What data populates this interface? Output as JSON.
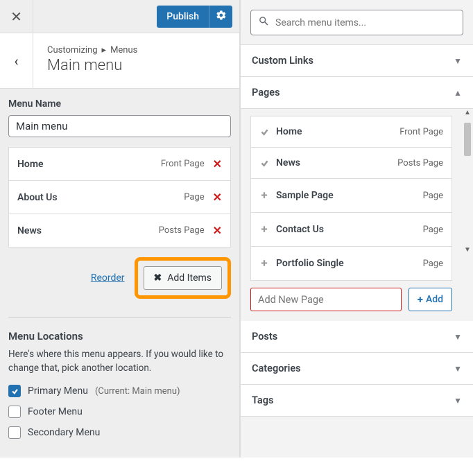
{
  "header": {
    "publish_label": "Publish"
  },
  "crumb": {
    "section": "Customizing",
    "parent": "Menus",
    "title": "Main menu"
  },
  "menu_name": {
    "label": "Menu Name",
    "value": "Main menu"
  },
  "menu_items": [
    {
      "title": "Home",
      "type": "Front Page"
    },
    {
      "title": "About Us",
      "type": "Page"
    },
    {
      "title": "News",
      "type": "Posts Page"
    }
  ],
  "actions": {
    "reorder": "Reorder",
    "add_items": "Add Items"
  },
  "locations": {
    "heading": "Menu Locations",
    "desc": "Here's where this menu appears. If you would like to change that, pick another location.",
    "items": [
      {
        "label": "Primary Menu",
        "sub": "(Current: Main menu)",
        "checked": true
      },
      {
        "label": "Footer Menu",
        "sub": "",
        "checked": false
      },
      {
        "label": "Secondary Menu",
        "sub": "",
        "checked": false
      }
    ]
  },
  "search": {
    "placeholder": "Search menu items..."
  },
  "sections": {
    "custom_links": "Custom Links",
    "pages": "Pages",
    "posts": "Posts",
    "categories": "Categories",
    "tags": "Tags"
  },
  "pages_list": [
    {
      "title": "Home",
      "type": "Front Page",
      "added": true
    },
    {
      "title": "News",
      "type": "Posts Page",
      "added": true
    },
    {
      "title": "Sample Page",
      "type": "Page",
      "added": false
    },
    {
      "title": "Contact Us",
      "type": "Page",
      "added": false
    },
    {
      "title": "Portfolio Single",
      "type": "Page",
      "added": false
    }
  ],
  "new_page": {
    "placeholder": "Add New Page",
    "button": "Add"
  }
}
